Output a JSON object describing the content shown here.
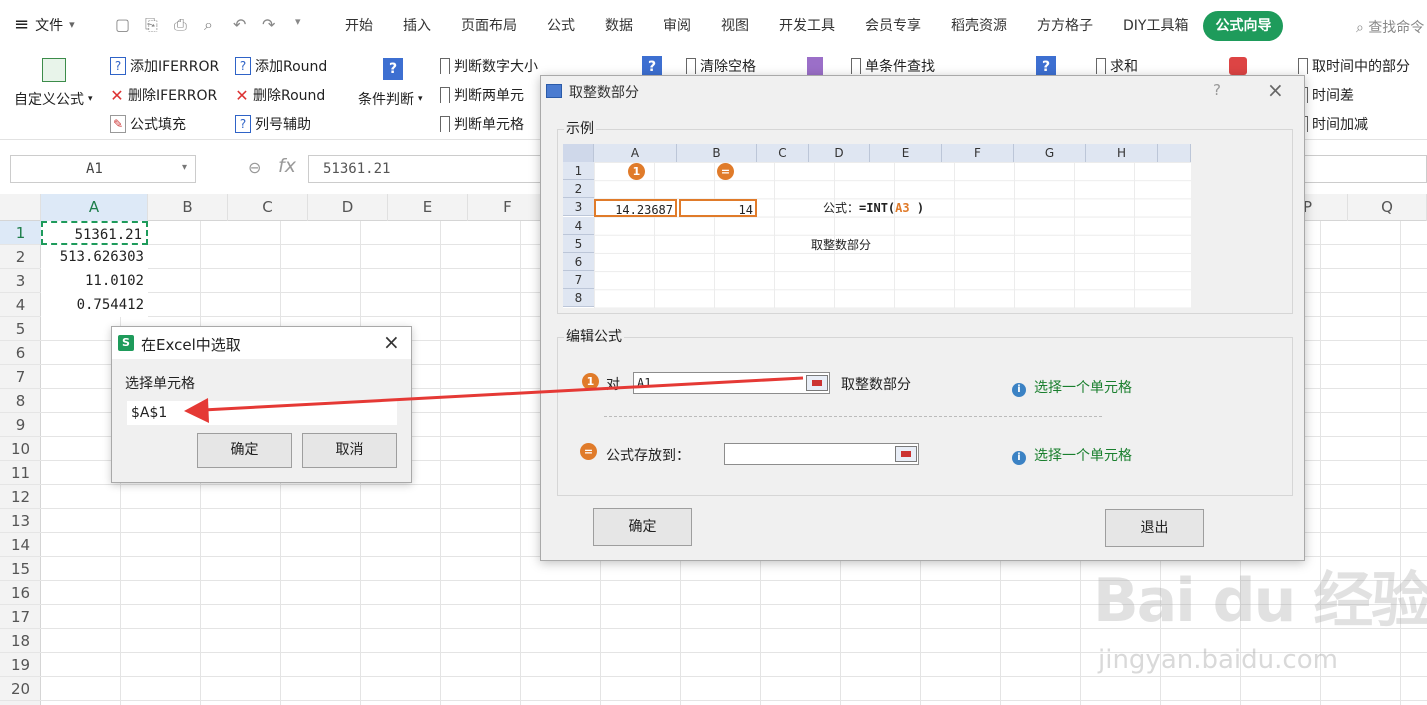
{
  "menu": {
    "file_label": "文件",
    "tabs": [
      "开始",
      "插入",
      "页面布局",
      "公式",
      "数据",
      "审阅",
      "视图",
      "开发工具",
      "会员专享",
      "稻壳资源",
      "方方格子",
      "DIY工具箱",
      "公式向导"
    ],
    "search_label": "查找命令"
  },
  "ribbon": {
    "custom_formula": "自定义公式",
    "add_iferror": "添加IFERROR",
    "del_iferror": "删除IFERROR",
    "formula_fill": "公式填充",
    "add_round": "添加Round",
    "del_round": "删除Round",
    "col_helper": "列号辅助",
    "cond_judge": "条件判断",
    "judge_size": "判断数字大小",
    "judge_two": "判断两单元",
    "judge_cell": "判断单元格",
    "clear_space": "清除空格",
    "single_lookup": "单条件查找",
    "sum": "求和",
    "get_time_part": "取时间中的部分",
    "time_diff": "时间差",
    "time_add": "时间加减"
  },
  "formula_bar": {
    "name_box": "A1",
    "fx": "fx",
    "value": "51361.21"
  },
  "sheet": {
    "columns": [
      "A",
      "B",
      "C",
      "D",
      "E",
      "F",
      "P",
      "Q"
    ],
    "rows": [
      "1",
      "2",
      "3",
      "4",
      "5",
      "6",
      "7",
      "8",
      "9",
      "10",
      "11",
      "12",
      "13",
      "14",
      "15",
      "16",
      "17",
      "18",
      "19",
      "20"
    ],
    "cells": [
      "51361.21",
      "513.626303",
      "11.0102",
      "0.754412"
    ]
  },
  "main_dialog": {
    "title": "取整数部分",
    "help": "?",
    "example_label": "示例",
    "example_cols": [
      "A",
      "B",
      "C",
      "D",
      "E",
      "F",
      "G",
      "H"
    ],
    "example_rows": [
      "1",
      "2",
      "3",
      "4",
      "5",
      "6",
      "7",
      "8"
    ],
    "example_a3": "14.23687",
    "example_b3": "14",
    "badge1": "1",
    "badge2": "=",
    "example_formula_prefix": "公式：",
    "example_formula_eq": "=INT(",
    "example_formula_ref": "A3",
    "example_formula_close": " )",
    "example_caption": "取整数部分",
    "edit_label": "编辑公式",
    "row1_prefix": "对",
    "row1_value": "A1",
    "row1_suffix": "取整数部分",
    "row1_hint": "选择一个单元格",
    "row2_label": "公式存放到：",
    "row2_value": "",
    "row2_hint": "选择一个单元格",
    "ok": "确定",
    "exit": "退出"
  },
  "pick_dialog": {
    "title": "在Excel中选取",
    "label": "选择单元格",
    "value": "$A$1",
    "ok": "确定",
    "cancel": "取消"
  },
  "watermark": {
    "main": "Bai du 经验",
    "sub": "jingyan.baidu.com"
  },
  "colors": {
    "accent": "#1e9b5b",
    "orange": "#e07b2a",
    "arrow": "#e53935"
  }
}
